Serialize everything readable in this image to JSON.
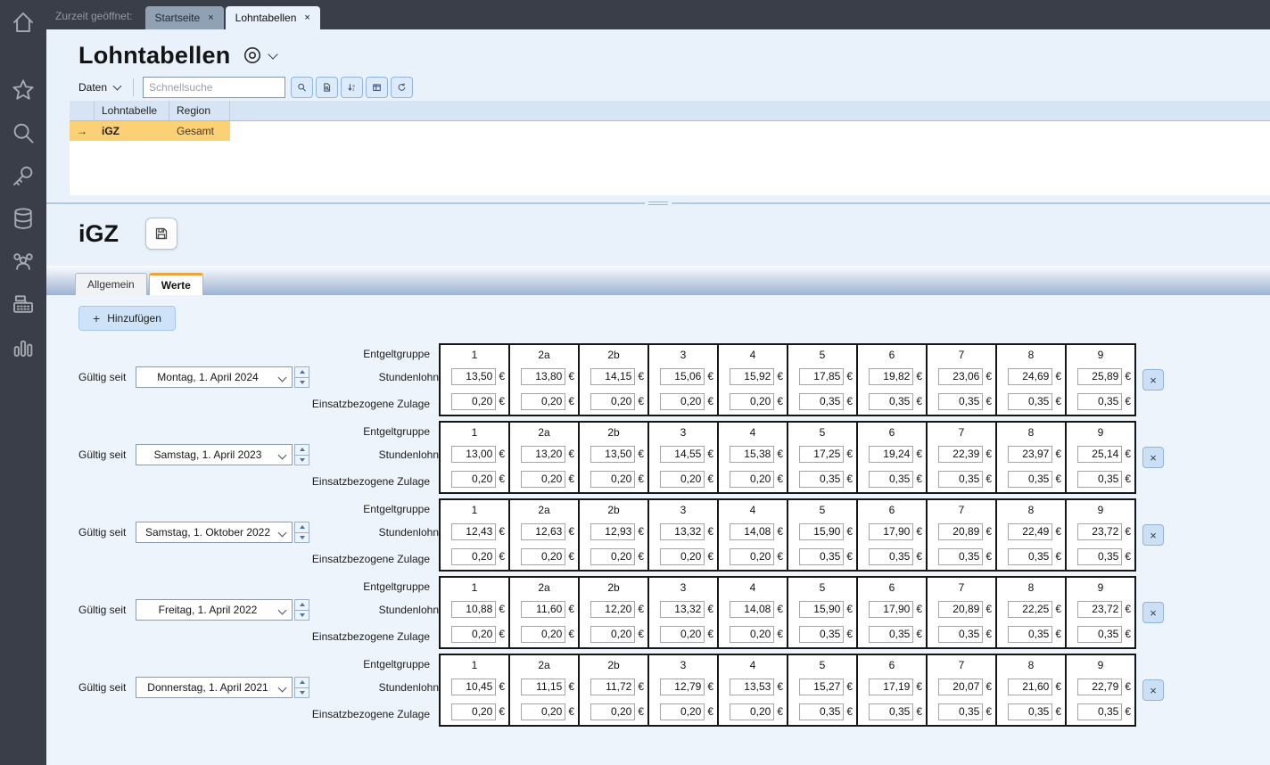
{
  "colors": {
    "topbar_bg": "#3a3e48",
    "selection_orange": "#fcd074",
    "tab_accent_orange": "#eca33c",
    "button_blue_bg": "#ddeafa",
    "grid_header_bg": "#d7e4f3"
  },
  "sidebar": {
    "icons": [
      "home",
      "star",
      "search",
      "key",
      "database",
      "users",
      "cash-register",
      "bar-chart"
    ]
  },
  "topbar": {
    "opened_label": "Zurzeit geöffnet:",
    "tabs": [
      {
        "label": "Startseite",
        "close": "×",
        "active": false
      },
      {
        "label": "Lohntabellen",
        "close": "×",
        "active": true
      }
    ]
  },
  "page": {
    "title": "Lohntabellen"
  },
  "toolbar": {
    "daten_label": "Daten",
    "search_placeholder": "Schnellsuche",
    "buttons": [
      "search",
      "file-preview",
      "sort",
      "columns",
      "refresh"
    ]
  },
  "grid": {
    "columns": [
      "Lohntabelle",
      "Region"
    ],
    "rows": [
      {
        "arrow": "→",
        "lohntabelle": "iGZ",
        "region": "Gesamt",
        "selected": true
      }
    ]
  },
  "detail": {
    "title": "iGZ",
    "tabs": [
      {
        "label": "Allgemein",
        "active": false
      },
      {
        "label": "Werte",
        "active": true
      }
    ],
    "add_plus": "+",
    "add_label": "Hinzufügen"
  },
  "werte": {
    "valid_since_label": "Gültig seit",
    "row_labels": {
      "group": "Entgeltgruppe",
      "wage": "Stundenlohn",
      "allowance": "Einsatzbezogene Zulage"
    },
    "groups": [
      "1",
      "2a",
      "2b",
      "3",
      "4",
      "5",
      "6",
      "7",
      "8",
      "9"
    ],
    "currency": "€",
    "delete_glyph": "×",
    "blocks": [
      {
        "date": "Montag, 1. April 2024",
        "wages": [
          "13,50",
          "13,80",
          "14,15",
          "15,06",
          "15,92",
          "17,85",
          "19,82",
          "23,06",
          "24,69",
          "25,89"
        ],
        "allowances": [
          "0,20",
          "0,20",
          "0,20",
          "0,20",
          "0,20",
          "0,35",
          "0,35",
          "0,35",
          "0,35",
          "0,35"
        ]
      },
      {
        "date": "Samstag, 1. April 2023",
        "wages": [
          "13,00",
          "13,20",
          "13,50",
          "14,55",
          "15,38",
          "17,25",
          "19,24",
          "22,39",
          "23,97",
          "25,14"
        ],
        "allowances": [
          "0,20",
          "0,20",
          "0,20",
          "0,20",
          "0,20",
          "0,35",
          "0,35",
          "0,35",
          "0,35",
          "0,35"
        ]
      },
      {
        "date": "Samstag, 1. Oktober 2022",
        "wages": [
          "12,43",
          "12,63",
          "12,93",
          "13,32",
          "14,08",
          "15,90",
          "17,90",
          "20,89",
          "22,49",
          "23,72"
        ],
        "allowances": [
          "0,20",
          "0,20",
          "0,20",
          "0,20",
          "0,20",
          "0,35",
          "0,35",
          "0,35",
          "0,35",
          "0,35"
        ]
      },
      {
        "date": "Freitag, 1. April 2022",
        "wages": [
          "10,88",
          "11,60",
          "12,20",
          "13,32",
          "14,08",
          "15,90",
          "17,90",
          "20,89",
          "22,25",
          "23,72"
        ],
        "allowances": [
          "0,20",
          "0,20",
          "0,20",
          "0,20",
          "0,20",
          "0,35",
          "0,35",
          "0,35",
          "0,35",
          "0,35"
        ]
      },
      {
        "date": "Donnerstag, 1. April 2021",
        "wages": [
          "10,45",
          "11,15",
          "11,72",
          "12,79",
          "13,53",
          "15,27",
          "17,19",
          "20,07",
          "21,60",
          "22,79"
        ],
        "allowances": [
          "0,20",
          "0,20",
          "0,20",
          "0,20",
          "0,20",
          "0,35",
          "0,35",
          "0,35",
          "0,35",
          "0,35"
        ]
      }
    ]
  }
}
